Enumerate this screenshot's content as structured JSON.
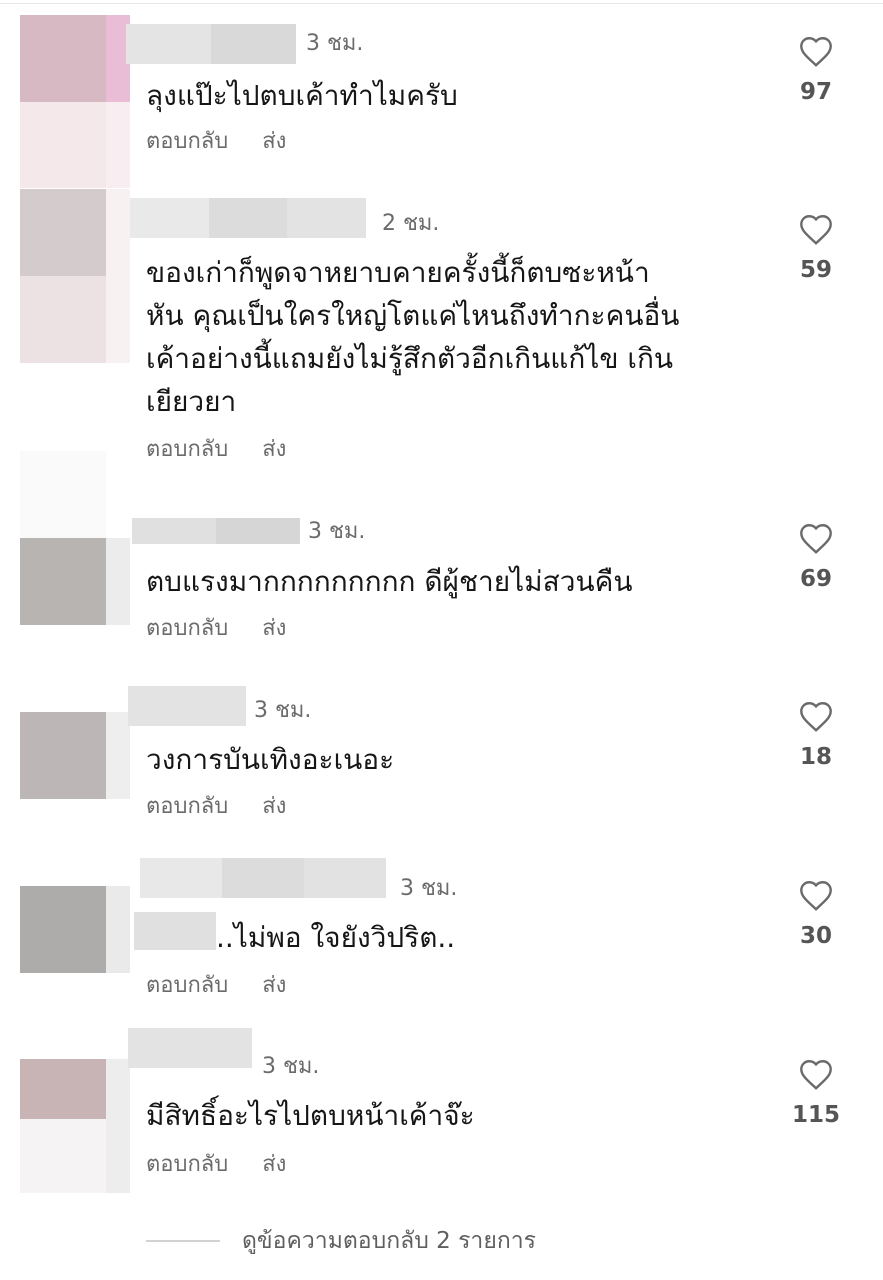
{
  "actions": {
    "reply_label": "ตอบกลับ",
    "send_label": "ส่ง"
  },
  "comments": [
    {
      "time": "3 ชม.",
      "text": "ลุงแป๊ะไปตบเค้าทำไมครับ",
      "likes": "97",
      "avatar_colors": [
        "#d6b9c2",
        "#f4e8ea"
      ]
    },
    {
      "time": "2 ชม.",
      "text": "ของเก่าก็พูดจาหยาบคายครั้งนี้ก็ตบซะหน้า\nหัน คุณเป็นใครใหญ่โตแค่ไหนถึงทำกะคนอื่น\nเค้าอย่างนี้แถมยังไม่รู้สึกตัวอีกเกินแก้ไข เกิน\nเยียวยา",
      "likes": "59",
      "avatar_colors": [
        "#d4cccc",
        "#ece2e4"
      ]
    },
    {
      "time": "3 ชม.",
      "text": "ตบแรงมากกกกกกกกก ดีผู้ชายไม่สวนคืน",
      "likes": "69",
      "avatar_colors": [
        "#b8b4b2",
        "#f3f3f3"
      ]
    },
    {
      "time": "3 ชม.",
      "text": "วงการบันเทิงอะเนอะ",
      "likes": "18",
      "avatar_colors": [
        "#bdb6b6",
        "#f5f5f5"
      ]
    },
    {
      "time": "3 ชม.",
      "text": "..ไม่พอ ใจยังวิปริต..",
      "likes": "30",
      "avatar_colors": [
        "#aeacaa",
        "#f5f5f5"
      ]
    },
    {
      "time": "3 ชม.",
      "text": "มีสิทธิ์อะไรไปตบหน้าเค้าจ๊ะ",
      "likes": "115",
      "avatar_colors": [
        "#c8b4b4",
        "#f5f3f3"
      ]
    }
  ],
  "footer": {
    "view_replies": "ดูข้อความตอบกลับ 2 รายการ"
  },
  "icons": {
    "like": "heart-outline-icon"
  }
}
